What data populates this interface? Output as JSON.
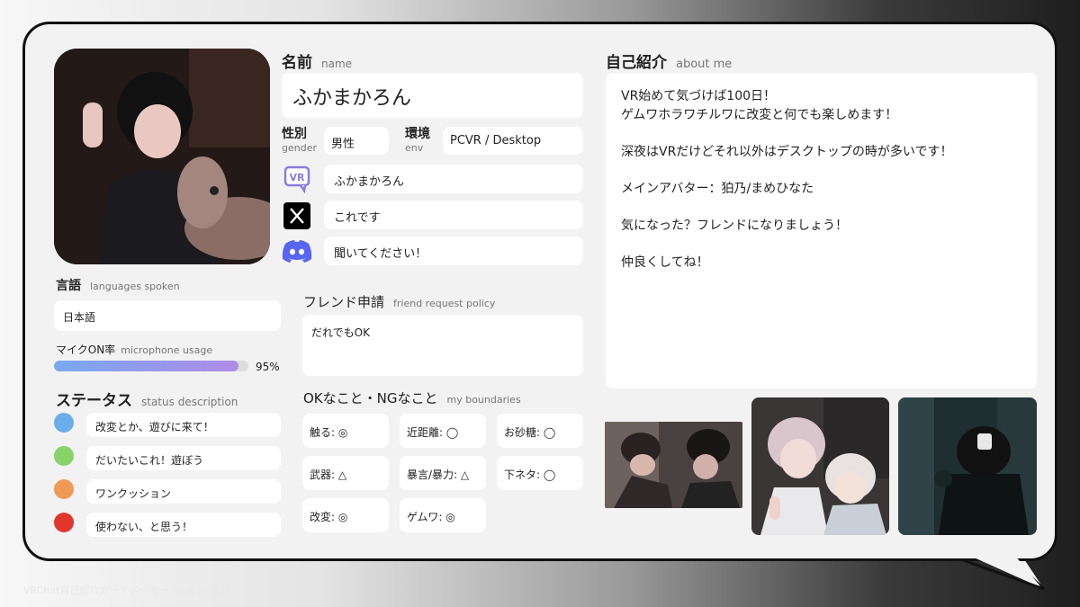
{
  "profile": {
    "name_label": "名前",
    "name_label_en": "name",
    "name": "ふかまかろん",
    "gender_label": "性別",
    "gender_label_en": "gender",
    "gender": "男性",
    "env_label": "環境",
    "env_label_en": "env",
    "env": "PCVR / Desktop",
    "vrchat_name": "ふかまかろん",
    "x_account": "これです",
    "discord": "聞いてください！",
    "vr_icon_text": "VR"
  },
  "languages": {
    "label": "言語",
    "label_en": "languages spoken",
    "value": "日本語"
  },
  "mic": {
    "label": "マイクON率",
    "label_en": "microphone usage",
    "percent_text": "95%",
    "value": 0.95
  },
  "status": {
    "label": "ステータス",
    "label_en": "status description",
    "items": [
      {
        "color": "#6aaeea",
        "text": "改変とか、遊びに来て！"
      },
      {
        "color": "#86d36a",
        "text": "だいたいこれ！遊ぼう"
      },
      {
        "color": "#ee9a55",
        "text": "ワンクッション"
      },
      {
        "color": "#e2362d",
        "text": "使わない、と思う！"
      }
    ]
  },
  "friend": {
    "label": "フレンド申請",
    "label_en": "friend request policy",
    "value": "だれでもOK"
  },
  "boundaries": {
    "label": "OKなこと・NGなこと",
    "label_en": "my boundaries",
    "items": [
      "触る: ◎",
      "近距離: ◯",
      "お砂糖: ◯",
      "武器: △",
      "暴言/暴力: △",
      "下ネタ: ◯",
      "改変: ◎",
      "ゲムワ: ◎"
    ]
  },
  "about": {
    "label": "自己紹介",
    "label_en": "about me",
    "lines": [
      "VR始めて気づけば100日！",
      "ゲムワホラワチルワに改変と何でも楽しめます！",
      "",
      "深夜はVRだけどそれ以外はデスクトップの時が多いです！",
      "",
      "メインアバター：狛乃/まめひなた",
      "",
      "気になった？フレンドになりましょう！",
      "",
      "仲良くしてね！"
    ]
  },
  "footer": "VRChat自己紹介カードメーカー by @yota3d",
  "colors": {
    "accent": "#5865f2",
    "bar_start": "#7aa8f0",
    "bar_end": "#b08ce8",
    "vr": "#8b7be0"
  }
}
